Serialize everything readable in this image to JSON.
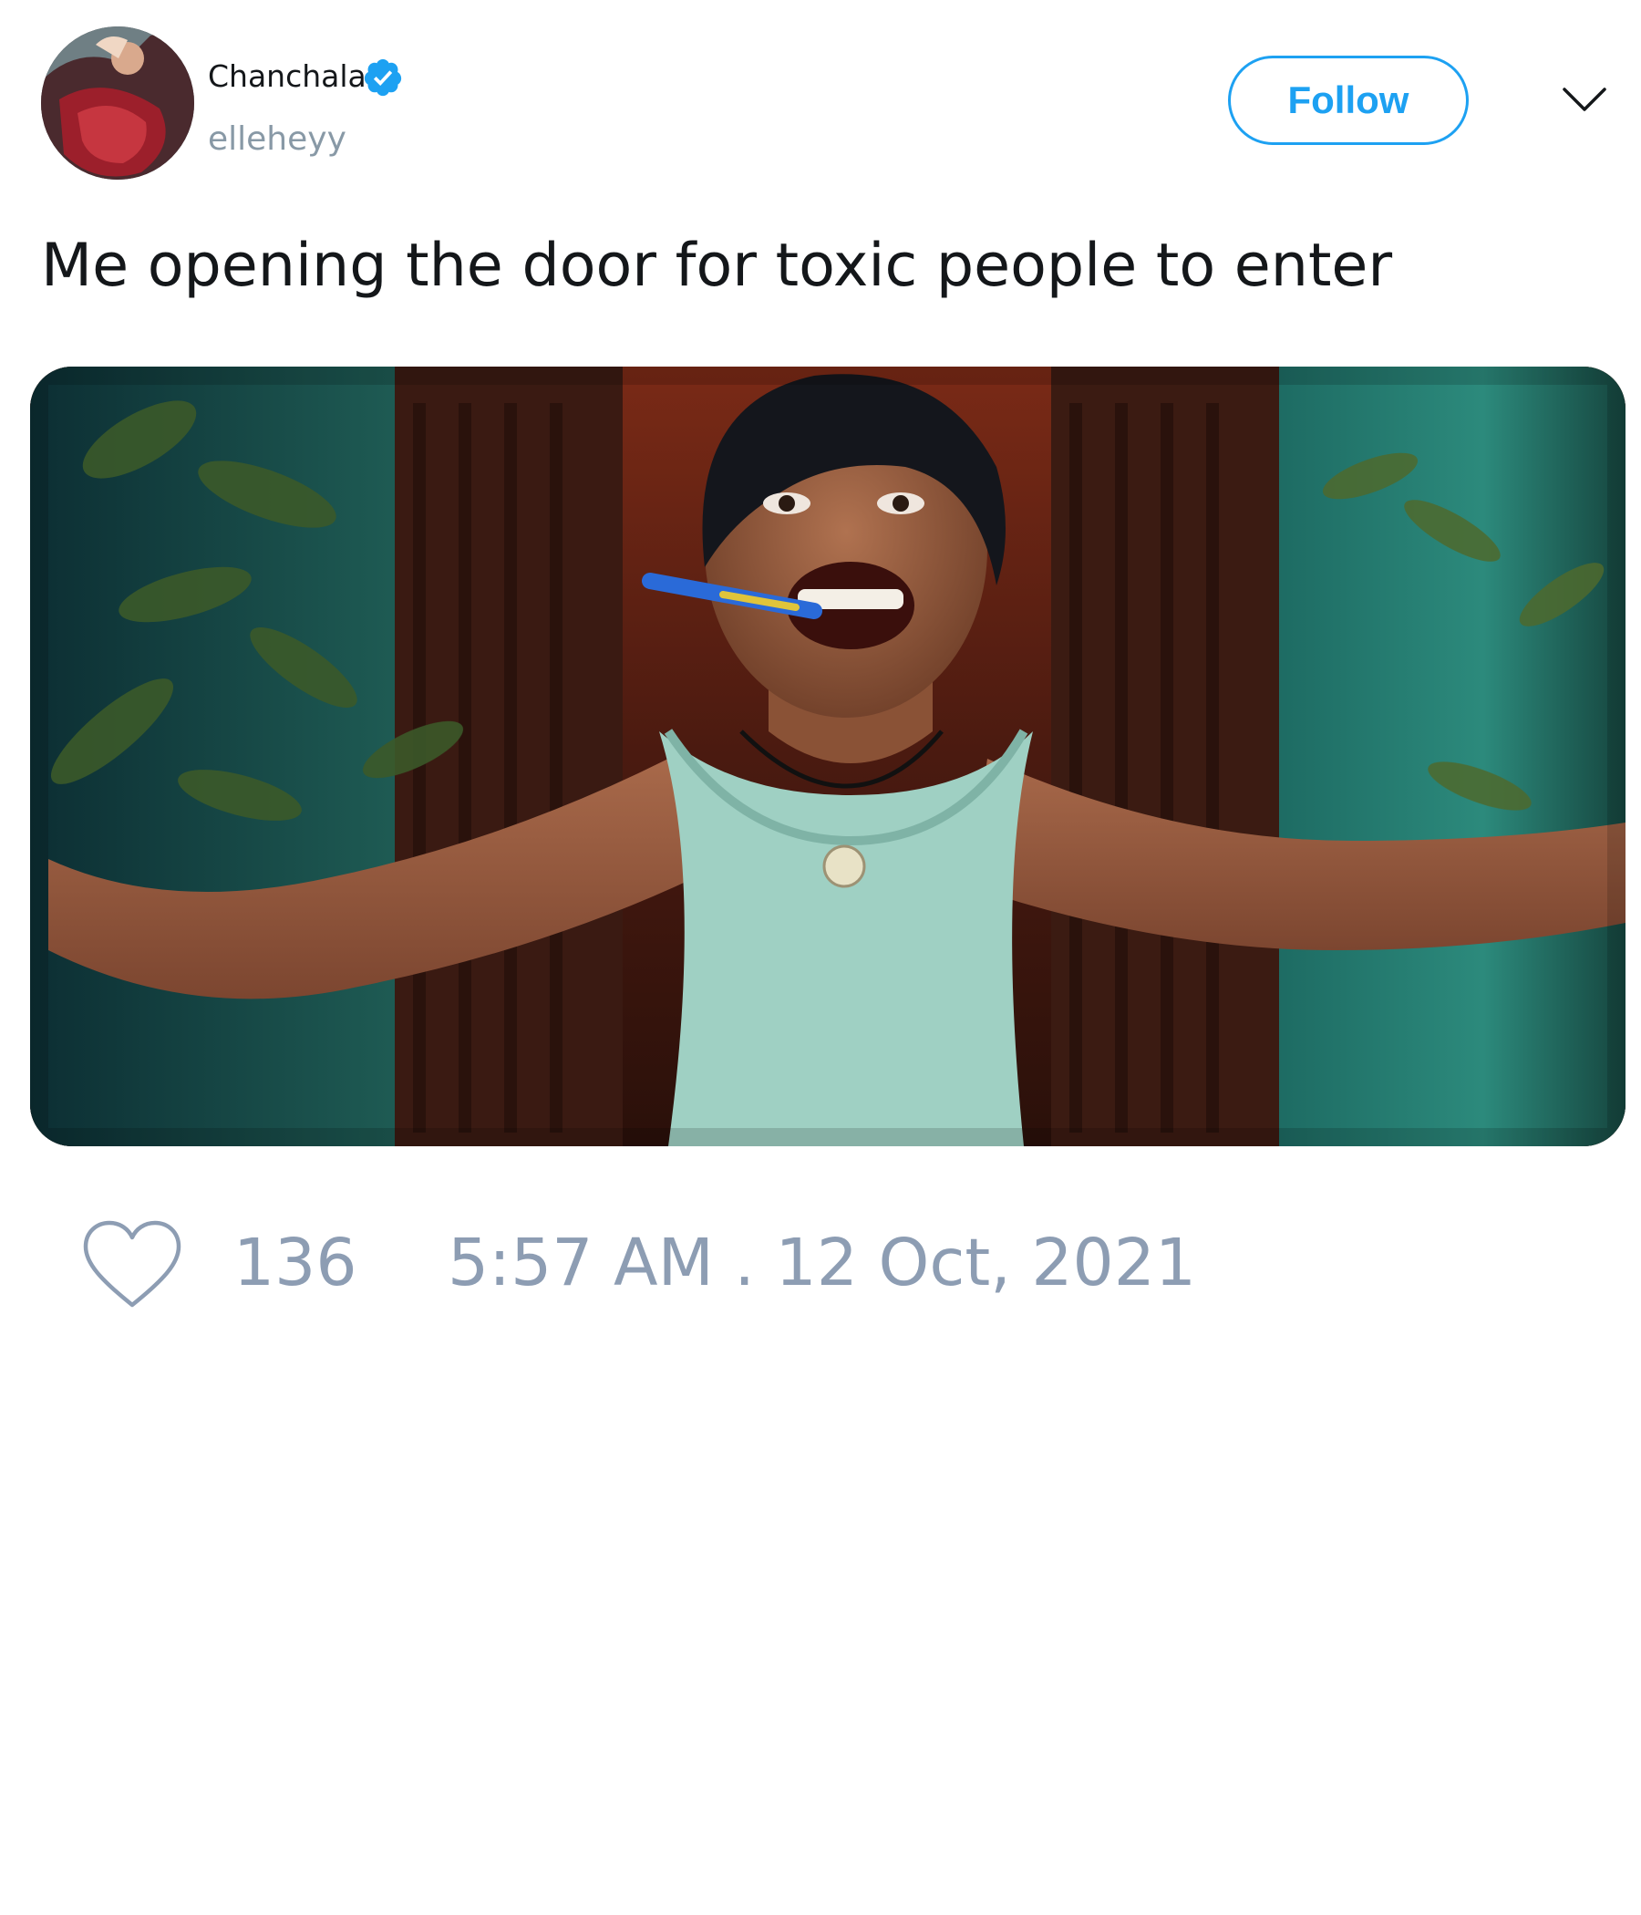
{
  "tweet": {
    "author": {
      "display_name": "Chanchala",
      "handle": "elleheyy",
      "verified": true
    },
    "follow_label": "Follow",
    "text": "Me opening the door for toxic people to enter",
    "media": {
      "kind": "photo"
    },
    "likes": "136",
    "timestamp": "5:57 AM . 12 Oct, 2021"
  },
  "icons": {
    "verified": "verified-badge-icon",
    "menu": "chevron-down-icon",
    "like": "heart-icon"
  },
  "colors": {
    "accent": "#1da1f2",
    "text_primary": "#14171a",
    "text_secondary": "#8899a6",
    "meta_text": "#8d9db3"
  }
}
